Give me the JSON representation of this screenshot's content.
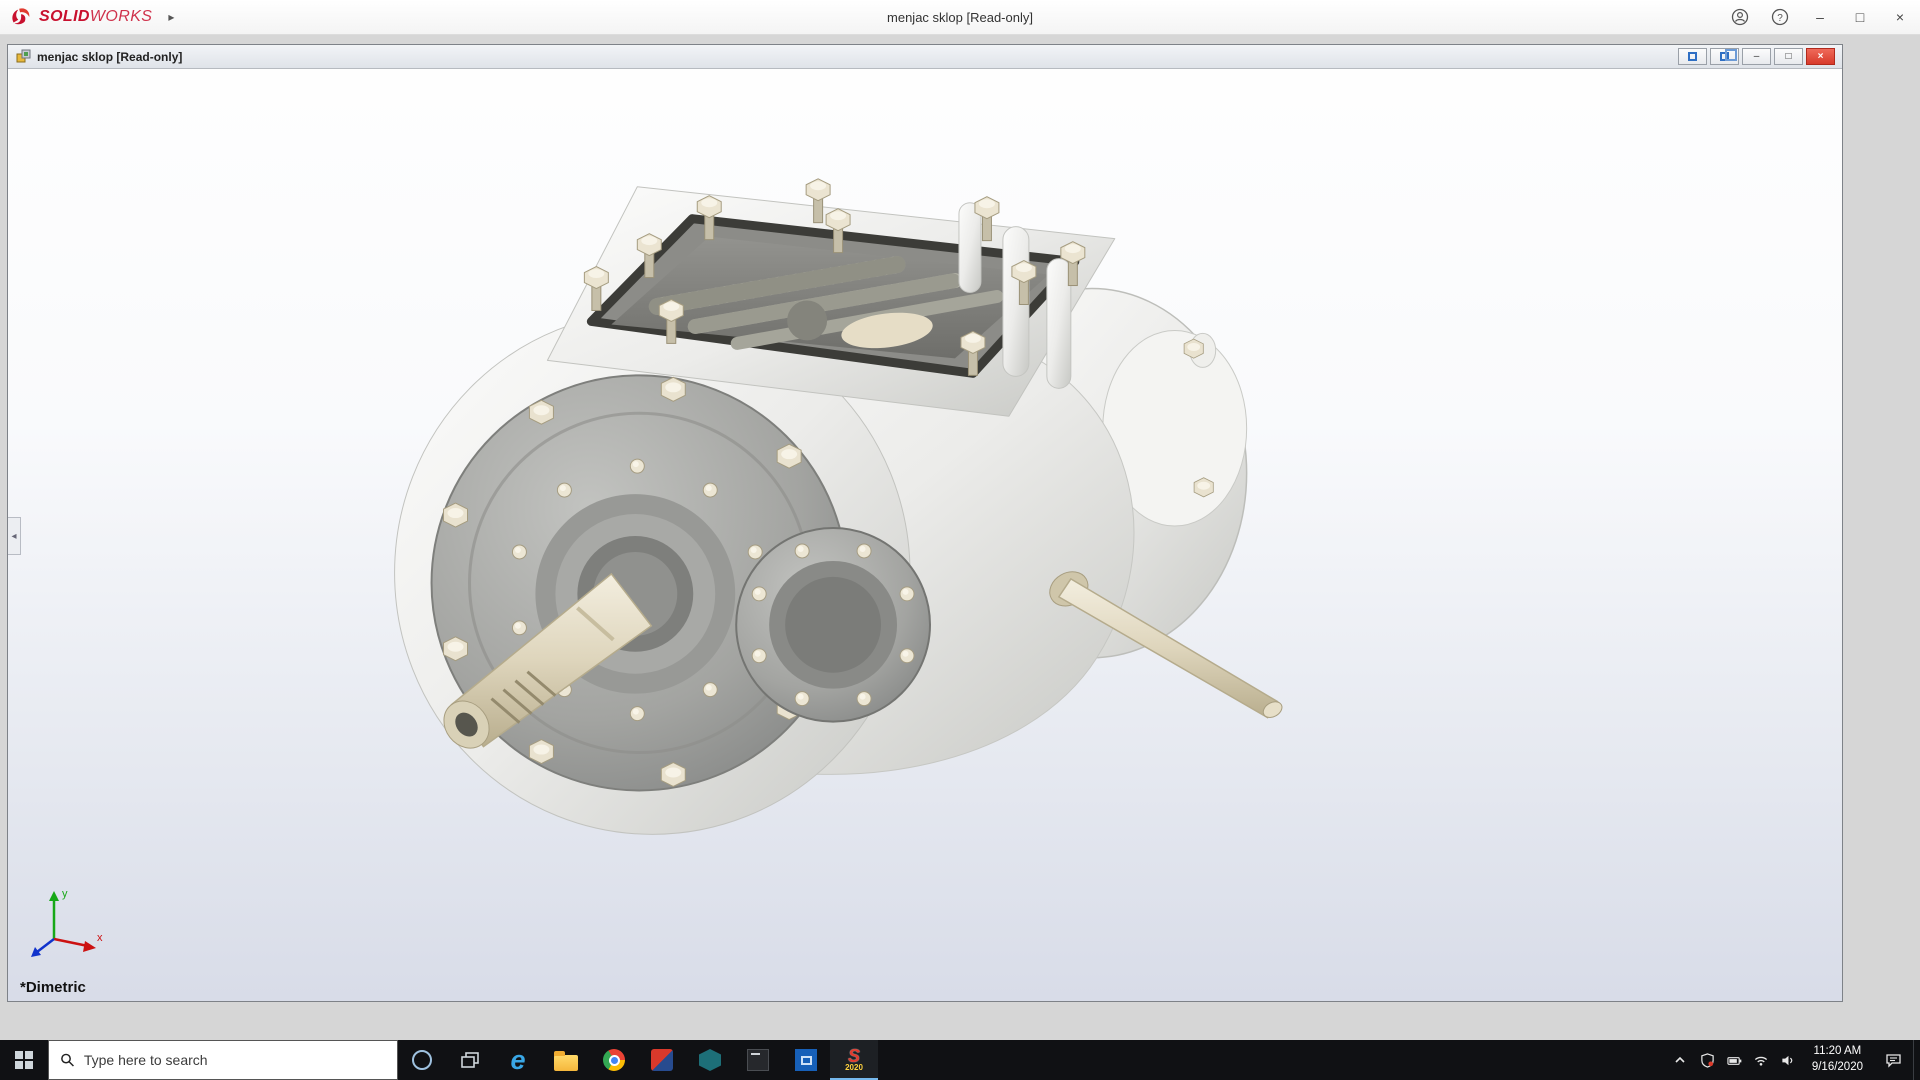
{
  "app": {
    "brand_bold": "SOLID",
    "brand_light": "WORKS",
    "window_title": "menjac sklop [Read-only]"
  },
  "doc": {
    "title": "menjac sklop [Read-only]"
  },
  "viewport": {
    "view_label": "*Dimetric",
    "triad": {
      "x": "x",
      "y": "y"
    }
  },
  "taskbar": {
    "search_placeholder": "Type here to search",
    "clock_time": "11:20 AM",
    "clock_date": "9/16/2020",
    "sw_year_badge": "2020"
  },
  "icons": {
    "help_glyph": "?",
    "minimize_glyph": "–",
    "restore_glyph": "□",
    "close_glyph": "×",
    "doc_minimize_glyph": "–",
    "doc_restore_glyph": "□",
    "doc_close_glyph": "×",
    "flyout_arrow_glyph": "▸",
    "panel_collapse_glyph": "◂",
    "edge_glyph": "e",
    "solidworks_glyph": "S"
  },
  "colors": {
    "brand_red": "#c8102e",
    "close_red": "#d83a2b",
    "taskbar_dark": "#101114",
    "triad_x_red": "#cc1111",
    "triad_y_green": "#17a817",
    "triad_z_blue": "#1133cc"
  }
}
